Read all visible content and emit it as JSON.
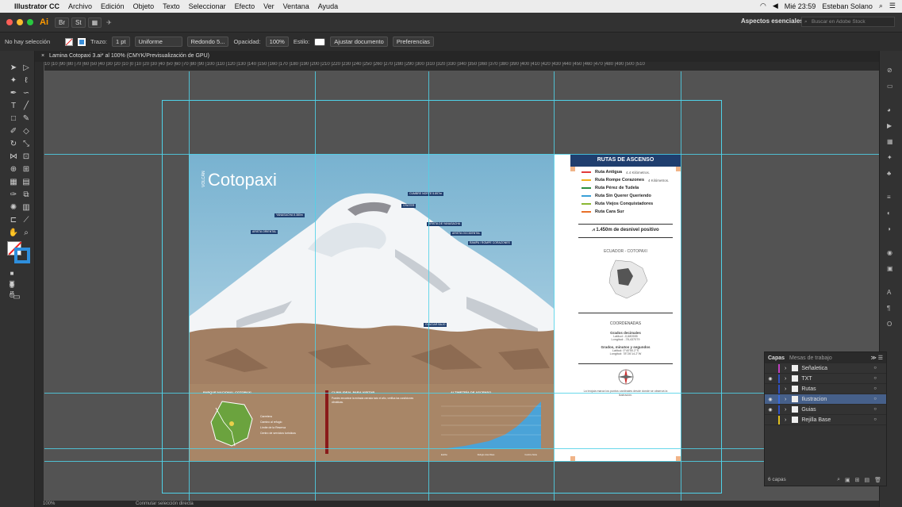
{
  "menubar": {
    "app": "Illustrator CC",
    "items": [
      "Archivo",
      "Edición",
      "Objeto",
      "Texto",
      "Seleccionar",
      "Efecto",
      "Ver",
      "Ventana",
      "Ayuda"
    ],
    "datetime": "Mié 23:59",
    "user": "Esteban Solano"
  },
  "appbar": {
    "logo": "Ai",
    "workspace": "Aspectos esenciales",
    "search_placeholder": "Buscar en Adobe Stock"
  },
  "control": {
    "selection": "No hay selección",
    "stroke_label": "Trazo:",
    "stroke_value": "1 pt",
    "uniform": "Uniforme",
    "brush": "Redondo 5...",
    "opacity_label": "Opacidad:",
    "opacity_value": "100%",
    "style_label": "Estilo:",
    "adjust": "Ajustar documento",
    "prefs": "Preferencias"
  },
  "document": {
    "tab": "Lamina Cotopaxi 3.ai* al 100% (CMYK/Previsualización de GPU)",
    "zoom": "100%",
    "status": "Conmutar selección directa"
  },
  "ruler": "10 |10 |90 |80 |70 |60 |50 |40 |30 |20 |10 |0 |10 |20 |30 |40 |50 |60 |70 |80 |90 |100 |110 |120 |130 |140 |150 |160 |170 |180 |190 |200 |210 |220 |230 |240 |250 |260 |270 |280 |290 |300 |310 |320 |330 |340 |350 |360 |370 |380 |390 |400 |410 |420 |430 |440 |450 |460 |470 |480 |490 |500 |510",
  "poster": {
    "title": "Cotopaxi",
    "title_side": "VOLCÁN",
    "callouts": [
      "CUMBRE NORTE 5.897m",
      "CRÁTER",
      "YANASACHA 5.380m",
      "ARISTA DE YANASACHA",
      "ARISTA ORIENTAL",
      "ARISTA OCCIDENTAL",
      "RAMPA / ROMPE CORAZONES",
      "GLACIAR BAJO"
    ],
    "bottom": {
      "park_title": "PARQUE NACIONAL COTOPAXI",
      "legend": [
        "Carretera",
        "Camino al refugio",
        "Límite de la Reserva",
        "Centro de servicios turísticos"
      ],
      "climate_title": "CLIMA IDEAL PARA VISITAR",
      "climate_text": "Puedes encontrar la entrada cerrada todo el año, verifica las condiciones climáticas.",
      "chart_title": "ALTIMETRÍA DE ASCENSO",
      "chart_labels": [
        "Estribo",
        "Refugio José Rivas",
        "Cumbre Norte"
      ]
    },
    "right": {
      "header": "RUTAS DE ASCENSO",
      "routes": [
        {
          "name": "Ruta Antigua",
          "sub": "4.4 Kilómetros.",
          "color": "#e23b3b"
        },
        {
          "name": "Ruta Rompe Corazones",
          "sub": "4 Kilómetros.",
          "color": "#f0b020"
        },
        {
          "name": "Ruta Pérez de Tudela",
          "sub": "",
          "color": "#2a8f3e"
        },
        {
          "name": "Ruta Sin Querer Queriendo",
          "sub": "",
          "color": "#3aa0d8"
        },
        {
          "name": "Ruta Viejos Conquistadores",
          "sub": "",
          "color": "#8ab832"
        },
        {
          "name": "Ruta Cara Sur",
          "sub": "",
          "color": "#e8702a"
        }
      ],
      "elevation": "1.450m de desnivel positivo",
      "map_title": "ECUADOR - COTOPAXI",
      "coords_title": "COORDENADAS",
      "decimal_title": "Grados decimales",
      "lat": "Latitud: -0,680595",
      "lon": "Longitud: -78,437079",
      "gms_title": "Grados, minutos y segundos",
      "lat2": "Latitud: 0°40'50.2\"S",
      "lon2": "Longitud: 78°26'14.2\"W",
      "compass_text": "La brújula marca los puntos cardinales desde donde se observa la ilustración."
    }
  },
  "layers": {
    "tabs": [
      "Capas",
      "Mesas de trabajo"
    ],
    "rows": [
      {
        "name": "Señaletica",
        "color": "#c040c0",
        "eye": false,
        "selected": false
      },
      {
        "name": "TXT",
        "color": "#3050c0",
        "eye": true,
        "selected": false
      },
      {
        "name": "Rutas",
        "color": "#3050c0",
        "eye": false,
        "selected": false
      },
      {
        "name": "Ilustracion",
        "color": "#3a6ad8",
        "eye": true,
        "selected": true
      },
      {
        "name": "Guias",
        "color": "#3050c0",
        "eye": true,
        "selected": false
      },
      {
        "name": "Rejilla Base",
        "color": "#e0c020",
        "eye": false,
        "selected": false
      }
    ],
    "count": "6 capas"
  }
}
